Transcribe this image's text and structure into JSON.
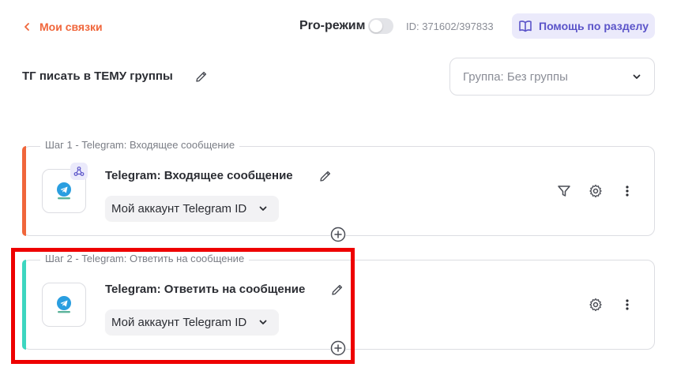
{
  "header": {
    "back_label": "Мои связки",
    "pro_mode_label": "Pro-режим",
    "id_text": "ID: 371602/397833",
    "help_label": "Помощь по разделу"
  },
  "bundle": {
    "title": "ТГ писать в ТЕМУ группы",
    "group_label": "Группа: Без группы"
  },
  "steps": [
    {
      "label": "Шаг 1 - Telegram: Входящее сообщение",
      "title": "Telegram: Входящее сообщение",
      "account": "Мой аккаунт Telegram ID",
      "accent_color": "#f0663b",
      "has_webhook_badge": true,
      "has_filter": true
    },
    {
      "label": "Шаг 2 - Telegram: Ответить на сообщение",
      "title": "Telegram: Ответить на сообщение",
      "account": "Мой аккаунт Telegram ID",
      "accent_color": "#3dd6c0",
      "has_webhook_badge": false,
      "has_filter": false
    }
  ],
  "colors": {
    "accent_orange": "#f0663b",
    "accent_teal": "#3dd6c0",
    "highlight_red": "#ee0000",
    "help_bg": "#ebeafb",
    "help_text": "#5b54c9"
  },
  "icons": {
    "back": "chevron-left-icon",
    "help": "book-icon",
    "edit": "pencil-icon",
    "dropdown": "chevron-down-icon",
    "app": "telegram-icon",
    "webhook": "webhook-icon",
    "filter": "filter-icon",
    "settings": "gear-icon",
    "more": "more-vertical-icon",
    "add": "plus-circle-icon"
  }
}
